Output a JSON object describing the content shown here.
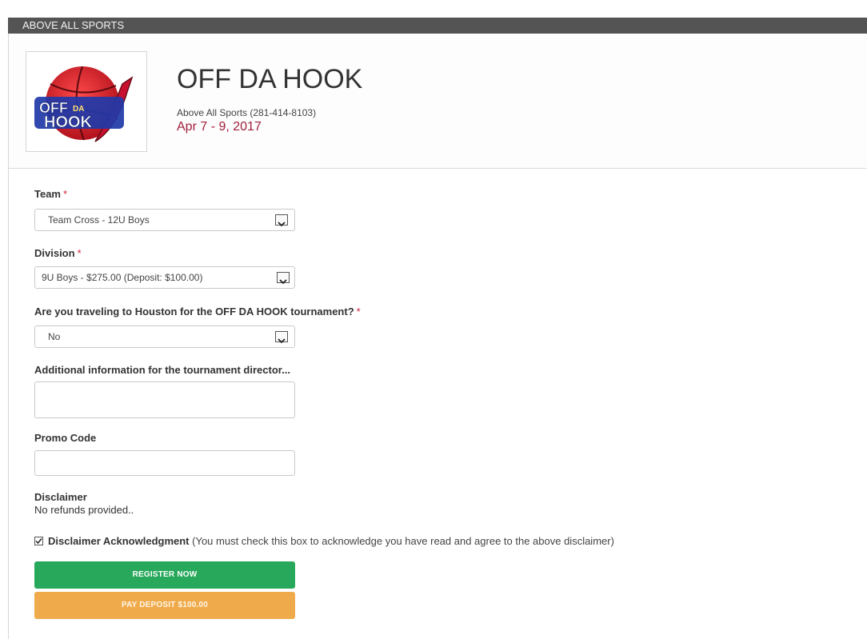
{
  "window": {
    "title": "ABOVE ALL SPORTS"
  },
  "event": {
    "logo_alt": "OFF DA HOOK",
    "title": "OFF DA HOOK",
    "organizer": "Above All Sports (281-414-8103)",
    "dates": "Apr 7 - 9, 2017"
  },
  "form": {
    "team": {
      "label": "Team",
      "required_mark": "*",
      "value": "Team Cross - 12U Boys"
    },
    "division": {
      "label": "Division",
      "required_mark": "*",
      "value": "9U Boys - $275.00 (Deposit: $100.00)"
    },
    "traveling": {
      "label": "Are you traveling to Houston for the OFF DA HOOK tournament?",
      "required_mark": "*",
      "value": "No"
    },
    "additional": {
      "label": "Additional information for the tournament director...",
      "value": ""
    },
    "promo": {
      "label": "Promo Code",
      "value": ""
    },
    "disclaimer": {
      "label": "Disclaimer",
      "text": "No refunds provided.."
    },
    "acknowledgment": {
      "checked": true,
      "label": "Disclaimer Acknowledgment",
      "hint": "(You must check this box to acknowledge you have read and agree to the above disclaimer)"
    },
    "buttons": {
      "register": "REGISTER NOW",
      "deposit": "PAY DEPOSIT $100.00"
    }
  },
  "colors": {
    "topbar": "#545454",
    "accent_date": "#a0203a",
    "required": "#d0243c",
    "register_button": "#27a85a",
    "deposit_button": "#efaa4b"
  }
}
